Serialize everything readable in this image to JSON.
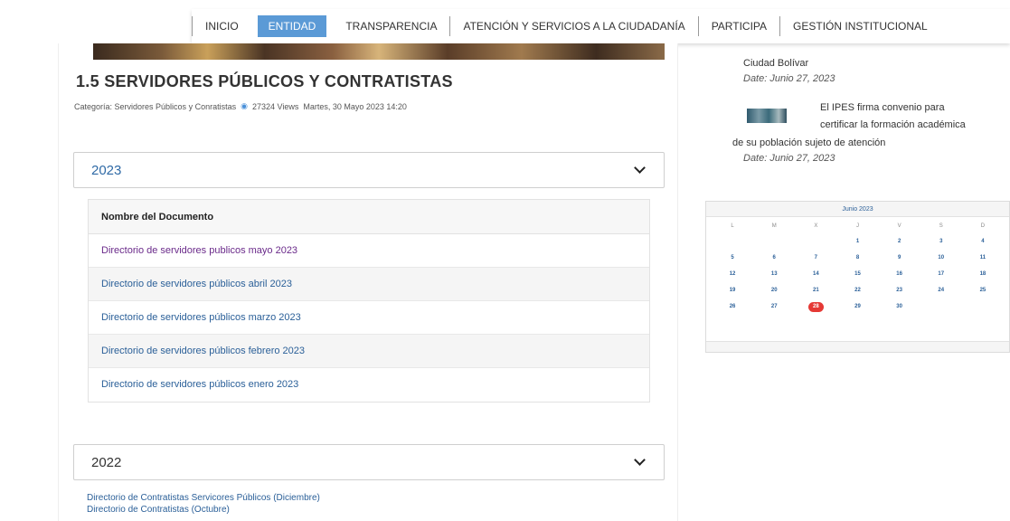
{
  "nav": {
    "items": [
      {
        "label": "INICIO",
        "active": false
      },
      {
        "label": "ENTIDAD",
        "active": true
      },
      {
        "label": "TRANSPARENCIA",
        "active": false
      },
      {
        "label": "ATENCIÓN Y SERVICIOS A LA CIUDADANÍA",
        "active": false
      },
      {
        "label": "PARTICIPA",
        "active": false
      },
      {
        "label": "GESTIÓN INSTITUCIONAL",
        "active": false
      }
    ]
  },
  "article": {
    "title": "1.5 SERVIDORES PÚBLICOS Y CONTRATISTAS",
    "category": "Categoría: Servidores Públicos y Conratistas",
    "views": "27324 Views",
    "date": "Martes, 30 Mayo 2023 14:20"
  },
  "accordion_2023": {
    "label": "2023",
    "table_header": "Nombre del Documento",
    "rows": [
      "Directorio de servidores publicos mayo 2023",
      "Directorio de servidores públicos abril 2023",
      "Directorio de servidores públicos marzo 2023",
      "Directorio de servidores públicos febrero 2023",
      "Directorio de servidores públicos enero 2023"
    ]
  },
  "accordion_2022": {
    "label": "2022",
    "links": [
      "Directorio de Contratistas Servicores Públicos (Diciembre)",
      "Directorio de Contratistas (Octubre)"
    ]
  },
  "news": {
    "item1_title": "Ciudad Bolívar",
    "item1_date": "Date: Junio 27, 2023",
    "item2_title_line1": "El IPES firma convenio para",
    "item2_title_line2": "certificar la formación académica",
    "item2_title_line3": "de su población sujeto de atención",
    "item2_date": "Date: Junio 27, 2023"
  },
  "calendar": {
    "title": "Junio 2023",
    "weekdays": [
      "L",
      "M",
      "X",
      "J",
      "V",
      "S",
      "D"
    ],
    "days": [
      "",
      "",
      "",
      "1",
      "2",
      "3",
      "4",
      "5",
      "6",
      "7",
      "8",
      "9",
      "10",
      "11",
      "12",
      "13",
      "14",
      "15",
      "16",
      "17",
      "18",
      "19",
      "20",
      "21",
      "22",
      "23",
      "24",
      "25",
      "26",
      "27",
      "28",
      "29",
      "30",
      "",
      ""
    ],
    "today": "28",
    "today_color": "#e53935"
  },
  "colors": {
    "accent": "#5b9ad6",
    "link": "#2a5f98",
    "visited_link": "#6a2a8a"
  }
}
